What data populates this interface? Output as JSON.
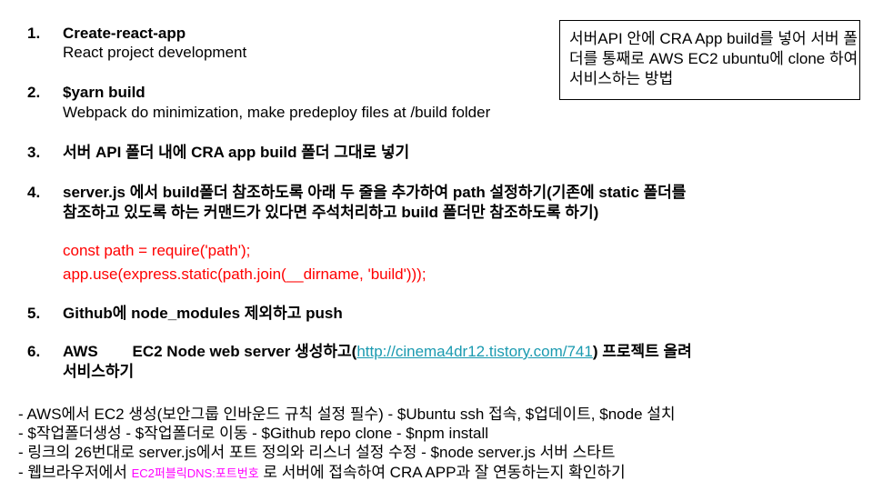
{
  "steps": [
    {
      "num": "1.",
      "title": "Create-react-app",
      "sub": "React project development"
    },
    {
      "num": "2.",
      "title": "$yarn build",
      "sub": "Webpack do minimization, make predeploy files at /build folder"
    },
    {
      "num": "3.",
      "title": "서버 API 폴더 내에 CRA app build 폴더 그대로 넣기"
    },
    {
      "num": "4.",
      "line1": "server.js 에서 build폴더 참조하도록 아래 두 줄을 추가하여 path 설정하기(기존에 static 폴더를",
      "line2": "참조하고 있도록 하는 커맨드가 있다면 주석처리하고 build 폴더만 참조하도록 하기)",
      "code1": "const path = require('path');",
      "code2": "app.use(express.static(path.join(__dirname, 'build')));"
    },
    {
      "num": "5.",
      "title": "Github에 node_modules 제외하고 push"
    },
    {
      "num": "6.",
      "pre": "AWS        EC2 Node web server 생성하고(",
      "link": "http://cinema4dr12.tistory.com/741",
      "post": ") 프로젝트 올려",
      "line2": "서비스하기"
    }
  ],
  "note": "서버API 안에 CRA App build를 넣어 서버 폴더를 통째로 AWS EC2 ubuntu에 clone 하여 서비스하는 방법",
  "bullets": {
    "b1": "- AWS에서 EC2 생성(보안그룹 인바운드 규칙 설정 필수) - $Ubuntu ssh 접속, $업데이트, $node 설치",
    "b2": "- $작업폴더생성 - $작업폴더로 이동 - $Github repo clone - $npm install",
    "b3": "- 링크의 26번대로 server.js에서 포트 정의와 리스너 설정 수정 - $node server.js 서버 스타트",
    "b4_pre": "- 웹브라우저에서 ",
    "b4_highlight": "EC2퍼블릭DNS:포트번호",
    "b4_post": " 로 서버에 접속하여 CRA APP과 잘 연동하는지 확인하기"
  },
  "colors": {
    "code": "#ff0000",
    "link": "#1a9ab0",
    "highlight": "#ff00ff"
  }
}
